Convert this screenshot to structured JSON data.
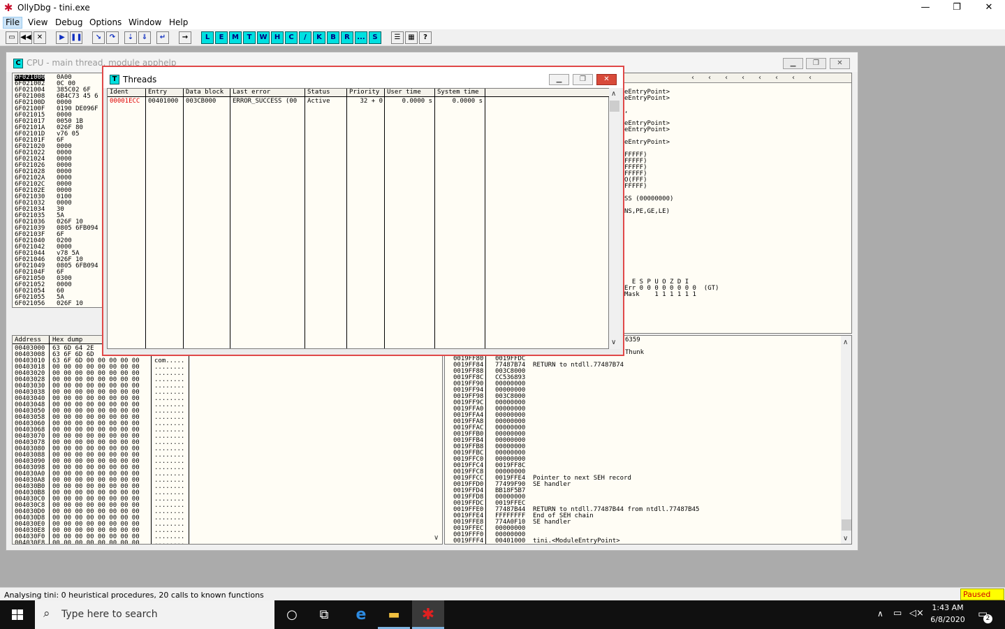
{
  "window": {
    "title": "OllyDbg - tini.exe",
    "minimize": "—",
    "maximize": "❐",
    "close": "✕"
  },
  "menu": [
    "File",
    "View",
    "Debug",
    "Options",
    "Window",
    "Help"
  ],
  "toolbar": {
    "letters": [
      "L",
      "E",
      "M",
      "T",
      "W",
      "H",
      "C",
      "/",
      "K",
      "B",
      "R",
      "...",
      "S"
    ]
  },
  "cpu": {
    "icon": "C",
    "title": "CPU - main thread, module apphelp",
    "disasm_addr": [
      "6F021000",
      "6F021002",
      "6F021004",
      "6F021008",
      "6F02100D",
      "6F02100F",
      "6F021015",
      "6F021017",
      "6F02101A",
      "6F02101D",
      "6F02101F",
      "6F021020",
      "6F021022",
      "6F021024",
      "6F021026",
      "6F021028",
      "6F02102A",
      "6F02102C",
      "6F02102E",
      "6F021030",
      "6F021032",
      "6F021034",
      "6F021035",
      "6F021036",
      "6F021039",
      "6F02103F",
      "6F021040",
      "6F021042",
      "6F021044",
      "6F021046",
      "6F021049",
      "6F02104F",
      "6F021050",
      "6F021052",
      "6F021054",
      "6F021055",
      "6F021056"
    ],
    "disasm_hex": [
      "0A00",
      "0C 00",
      "385C02 6F",
      "6B4C73 45 6",
      "0000",
      "0190 DE096F",
      "0000",
      "0050 1B",
      "026F 80",
      "v76 05",
      "6F",
      "0000",
      "0000",
      "0000",
      "0000",
      "0000",
      "0000",
      "0000",
      "0000",
      "0100",
      "0000",
      "30",
      "5A",
      "026F 10",
      "0805 6FB094",
      "6F",
      "0200",
      "0000",
      "v78 5A",
      "026F 10",
      "0805 6FB094",
      "6F",
      "0300",
      "0000",
      "60",
      "5A",
      "026F 10"
    ],
    "reg_lines": [
      "eEntryPoint>",
      "eEntryPoint>",
      "",
      ",",
      "",
      "eEntryPoint>",
      "eEntryPoint>",
      "",
      "eEntryPoint>",
      "",
      "FFFFF)",
      "FFFFF)",
      "FFFFF)",
      "FFFFF)",
      "O(FFF)",
      "FFFFF)",
      "",
      "SS (00000000)",
      "",
      "NS,PE,GE,LE)"
    ],
    "fpu_lines": [
      "  E S P U O Z D I",
      "Err 0 0 0 0 0 0 0 0  (GT)",
      "Mask    1 1 1 1 1 1"
    ],
    "dump_header": [
      "Address",
      "Hex dump"
    ],
    "dump_addr": [
      "00403000",
      "00403008",
      "00403010",
      "00403018",
      "00403020",
      "00403028",
      "00403030",
      "00403038",
      "00403040",
      "00403048",
      "00403050",
      "00403058",
      "00403060",
      "00403068",
      "00403070",
      "00403078",
      "00403080",
      "00403088",
      "00403090",
      "00403098",
      "004030A0",
      "004030A8",
      "004030B0",
      "004030B8",
      "004030C0",
      "004030C8",
      "004030D0",
      "004030D8",
      "004030E0",
      "004030E8",
      "004030F0",
      "004030F8"
    ],
    "dump_hex": [
      "63 6D 64 2E",
      "63 6F 6D 6D",
      "63 6F 6D 00 00 00 00 00",
      "00 00 00 00 00 00 00 00",
      "00 00 00 00 00 00 00 00",
      "00 00 00 00 00 00 00 00",
      "00 00 00 00 00 00 00 00",
      "00 00 00 00 00 00 00 00",
      "00 00 00 00 00 00 00 00",
      "00 00 00 00 00 00 00 00",
      "00 00 00 00 00 00 00 00",
      "00 00 00 00 00 00 00 00",
      "00 00 00 00 00 00 00 00",
      "00 00 00 00 00 00 00 00",
      "00 00 00 00 00 00 00 00",
      "00 00 00 00 00 00 00 00",
      "00 00 00 00 00 00 00 00",
      "00 00 00 00 00 00 00 00",
      "00 00 00 00 00 00 00 00",
      "00 00 00 00 00 00 00 00",
      "00 00 00 00 00 00 00 00",
      "00 00 00 00 00 00 00 00",
      "00 00 00 00 00 00 00 00",
      "00 00 00 00 00 00 00 00",
      "00 00 00 00 00 00 00 00",
      "00 00 00 00 00 00 00 00",
      "00 00 00 00 00 00 00 00",
      "00 00 00 00 00 00 00 00",
      "00 00 00 00 00 00 00 00",
      "00 00 00 00 00 00 00 00",
      "00 00 00 00 00 00 00 00",
      "00 00 00 00 00 00 00 00"
    ],
    "dump_ascii": [
      "",
      "",
      "com.....",
      "........",
      "........",
      "........",
      "........",
      "........",
      "........",
      "........",
      "........",
      "........",
      "........",
      "........",
      "........",
      "........",
      "........",
      "........",
      "........",
      "........",
      "........",
      "........",
      "........",
      "........",
      "........",
      "........",
      "........",
      "........",
      "........",
      "........",
      "........",
      "........"
    ],
    "stack_top": [
      "6359",
      "",
      "Thunk"
    ],
    "stack_addr": [
      "0019FF80",
      "0019FF84",
      "0019FF88",
      "0019FF8C",
      "0019FF90",
      "0019FF94",
      "0019FF98",
      "0019FF9C",
      "0019FFA0",
      "0019FFA4",
      "0019FFA8",
      "0019FFAC",
      "0019FFB0",
      "0019FFB4",
      "0019FFB8",
      "0019FFBC",
      "0019FFC0",
      "0019FFC4",
      "0019FFC8",
      "0019FFCC",
      "0019FFD0",
      "0019FFD4",
      "0019FFD8",
      "0019FFDC",
      "0019FFE0",
      "0019FFE4",
      "0019FFE8",
      "0019FFEC",
      "0019FFF0",
      "0019FFF4"
    ],
    "stack_val": [
      "0019FFDC",
      "77487B74",
      "003C8000",
      "CC536893",
      "00000000",
      "00000000",
      "003C8000",
      "00000000",
      "00000000",
      "00000000",
      "00000000",
      "00000000",
      "00000000",
      "00000000",
      "00000000",
      "00000000",
      "00000000",
      "0019FF8C",
      "00000000",
      "0019FFE4",
      "77499F90",
      "BB18F5B7",
      "00000000",
      "0019FFEC",
      "77487B44",
      "FFFFFFFF",
      "774A0F10",
      "00000000",
      "00000000",
      "00401000"
    ],
    "stack_cmt": [
      "",
      "RETURN to ntdll.77487B74",
      "",
      "",
      "",
      "",
      "",
      "",
      "",
      "",
      "",
      "",
      "",
      "",
      "",
      "",
      "",
      "",
      "",
      "Pointer to next SEH record",
      "SE handler",
      "",
      "",
      "",
      "RETURN to ntdll.77487B44 from ntdll.77487B45",
      "End of SEH chain",
      "SE handler",
      "",
      "",
      "tini.<ModuleEntryPoint>"
    ]
  },
  "threads": {
    "icon": "T",
    "title": "Threads",
    "columns": [
      "Ident",
      "Entry",
      "Data block",
      "Last error",
      "Status",
      "Priority",
      "User time",
      "System time"
    ],
    "row": {
      "ident": "00001ECC",
      "entry": "00401000",
      "data_block": "003CB000",
      "last_error": "ERROR_SUCCESS (00",
      "status": "Active",
      "priority": "32 + 0",
      "user_time": "0.0000 s",
      "system_time": "0.0000 s"
    }
  },
  "status": {
    "message": "Analysing tini: 0 heuristical procedures, 20 calls to known functions",
    "state": "Paused"
  },
  "taskbar": {
    "search_placeholder": "Type here to search",
    "time": "1:43 AM",
    "date": "6/8/2020",
    "notifications": "2"
  }
}
